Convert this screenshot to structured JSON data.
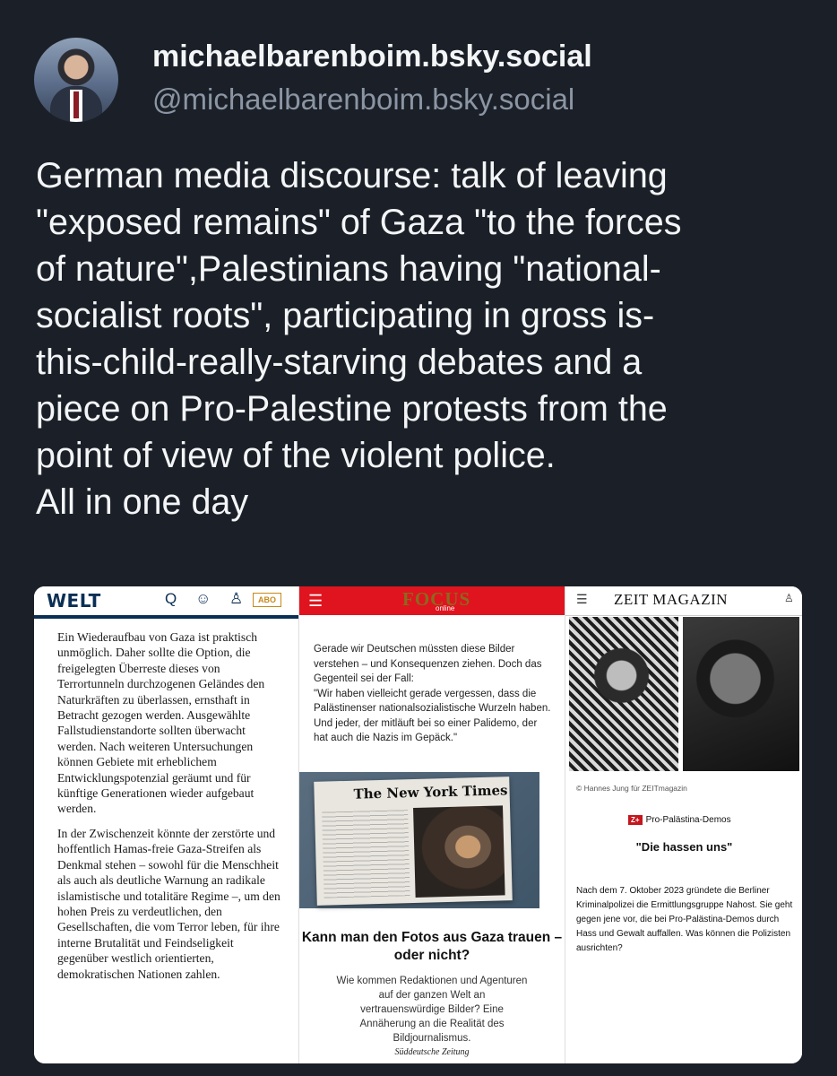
{
  "post": {
    "display_name": "michaelbarenboim.bsky.social",
    "handle": "@michaelbarenboim.bsky.social",
    "text": "German media discourse: talk of leaving\n\"exposed remains\" of Gaza \"to the forces\nof nature\",Palestinians having \"national-\nsocialist roots\", participating in gross is-\nthis-child-really-starving debates and a\npiece on Pro-Palestine protests from the\npoint of view of the violent police.\nAll in one day"
  },
  "welt": {
    "logo": "WELT",
    "icons": "Q ☺ ♙",
    "abo": "ABO",
    "p1": "Ein Wiederaufbau von Gaza ist praktisch unmöglich. Daher sollte die Option, die freigelegten Überreste dieses von Terrortunneln durchzogenen Geländes den Naturkräften zu überlassen, ernsthaft in Betracht gezogen werden. Ausgewählte Fallstudienstandorte sollten überwacht werden. Nach weiteren Untersuchungen können Gebiete mit erheblichem Entwicklungspotenzial geräumt und für künftige Generationen wieder aufgebaut werden.",
    "p2": "In der Zwischenzeit könnte der zerstörte und hoffentlich Hamas-freie Gaza-Streifen als Denkmal stehen – sowohl für die Menschheit als auch als deutliche Warnung an radikale islamistische und totalitäre Regime –, um den hohen Preis zu verdeutlichen, den Gesellschaften, die vom Terror leben, für ihre interne Brutalität und Feindseligkeit gegenüber westlich orientierten, demokratischen Nationen zahlen."
  },
  "focus": {
    "logo": "FOCUS",
    "sub": "online",
    "quote": "Gerade wir Deutschen müssten diese Bilder verstehen – und Konsequenzen ziehen. Doch das Gegenteil sei der Fall:\n\"Wir haben vielleicht gerade vergessen, dass die Palästinenser nationalsozialistische Wurzeln haben. Und jeder, der mitläuft bei so einer Palidemo, der hat auch die Nazis im Gepäck.\"",
    "nyt": "The New York Times",
    "title": "Kann man den Fotos aus Gaza trauen – oder nicht?",
    "subtitle": "Wie kommen Redaktionen und Agenturen auf der ganzen Welt an vertrauenswürdige Bilder? Eine Annäherung an die Realität des Bildjournalismus.",
    "source": "Süddeutsche Zeitung"
  },
  "zeit": {
    "logo": "ZEIT MAGAZIN",
    "credit": "© Hannes Jung für ZEITmagazin",
    "badge_z": "Z+",
    "badge": "Pro-Palästina-Demos",
    "headline": "\"Die hassen uns\"",
    "body": "Nach dem 7. Oktober 2023 gründete die Berliner Kriminalpolizei die Ermittlungsgruppe Nahost. Sie geht gegen jene vor, die bei Pro-Palästina-Demos durch Hass und Gewalt auffallen. Was können die Polizisten ausrichten?"
  }
}
